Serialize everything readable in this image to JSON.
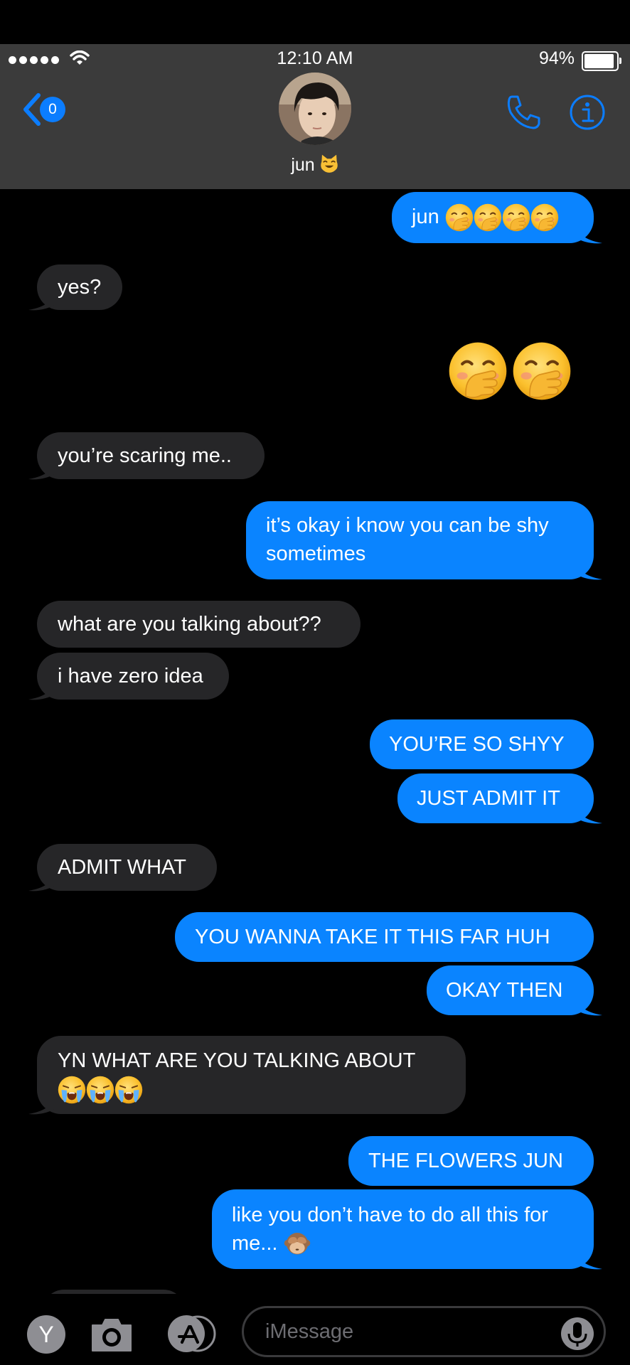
{
  "status_bar": {
    "time": "12:10 AM",
    "battery_percent_label": "94%",
    "battery_level": 0.94,
    "signal_bars": 5,
    "icons": [
      "signal-dots-icon",
      "wifi-icon",
      "battery-icon"
    ]
  },
  "header": {
    "back_badge_count": "0",
    "contact_name": "jun",
    "contact_emoji": "smiling-cat-face-icon",
    "actions": [
      "phone-icon",
      "info-icon"
    ]
  },
  "colors": {
    "sent_bubble": "#0a84ff",
    "received_bubble": "#262628",
    "header_bg": "#3b3b3b",
    "accent": "#0b7dff"
  },
  "messages": [
    {
      "direction": "sent",
      "text": "jun",
      "trailing_emoji": [
        "face-with-hand-over-mouth",
        "face-with-hand-over-mouth",
        "face-with-hand-over-mouth",
        "face-with-hand-over-mouth"
      ]
    },
    {
      "direction": "received",
      "text": "yes?"
    },
    {
      "direction": "sent",
      "big_emoji": [
        "face-with-hand-over-mouth",
        "face-with-hand-over-mouth"
      ]
    },
    {
      "direction": "received",
      "text": "you’re scaring me.."
    },
    {
      "direction": "sent",
      "lines": [
        "it’s okay i know you can be shy",
        "sometimes"
      ]
    },
    {
      "direction": "received",
      "text": "what are you talking about??"
    },
    {
      "direction": "received",
      "text": "i have zero idea"
    },
    {
      "direction": "sent",
      "text": "YOU’RE SO SHYY"
    },
    {
      "direction": "sent",
      "text": "JUST ADMIT IT"
    },
    {
      "direction": "received",
      "text": "ADMIT WHAT"
    },
    {
      "direction": "sent",
      "text": "YOU WANNA TAKE IT THIS FAR HUH"
    },
    {
      "direction": "sent",
      "text": "OKAY THEN"
    },
    {
      "direction": "received",
      "lines": [
        "YN WHAT ARE YOU TALKING ABOUT"
      ],
      "trailing_emoji": [
        "loudly-crying-face",
        "loudly-crying-face",
        "loudly-crying-face"
      ]
    },
    {
      "direction": "sent",
      "text": "THE FLOWERS JUN"
    },
    {
      "direction": "sent",
      "lines": [
        "like you don’t have to do all this for",
        "me..."
      ],
      "trailing_emoji": [
        "see-no-evil-monkey"
      ]
    }
  ],
  "input_bar": {
    "y_app_label": "Y",
    "placeholder": "iMessage",
    "icons": [
      "camera-icon",
      "app-store-icon",
      "microphone-icon"
    ]
  }
}
